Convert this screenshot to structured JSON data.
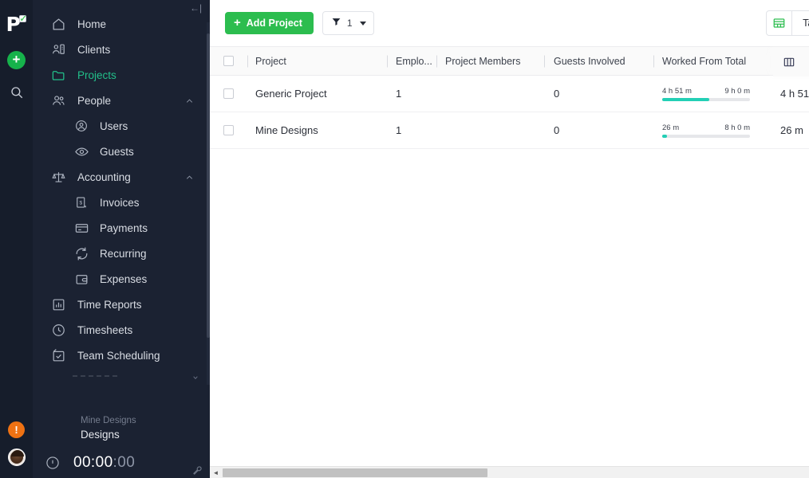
{
  "rail": {
    "logo_letter": "P",
    "logo_check": "✓",
    "add_label": "+",
    "search_icon": "search-icon",
    "alert_label": "!",
    "avatar_label": "avatar"
  },
  "sidebar": {
    "collapse_label": "←|",
    "items": [
      {
        "label": "Home",
        "icon": "home-icon",
        "level": 0,
        "active": false,
        "chevron": ""
      },
      {
        "label": "Clients",
        "icon": "clients-icon",
        "level": 0,
        "active": false,
        "chevron": ""
      },
      {
        "label": "Projects",
        "icon": "folder-icon",
        "level": 0,
        "active": true,
        "chevron": ""
      },
      {
        "label": "People",
        "icon": "people-icon",
        "level": 0,
        "active": false,
        "chevron": "up"
      },
      {
        "label": "Users",
        "icon": "user-circle-icon",
        "level": 1,
        "active": false,
        "chevron": ""
      },
      {
        "label": "Guests",
        "icon": "eye-icon",
        "level": 1,
        "active": false,
        "chevron": ""
      },
      {
        "label": "Accounting",
        "icon": "scales-icon",
        "level": 0,
        "active": false,
        "chevron": "up"
      },
      {
        "label": "Invoices",
        "icon": "invoice-icon",
        "level": 1,
        "active": false,
        "chevron": ""
      },
      {
        "label": "Payments",
        "icon": "card-icon",
        "level": 1,
        "active": false,
        "chevron": ""
      },
      {
        "label": "Recurring",
        "icon": "recurring-icon",
        "level": 1,
        "active": false,
        "chevron": ""
      },
      {
        "label": "Expenses",
        "icon": "wallet-icon",
        "level": 1,
        "active": false,
        "chevron": ""
      },
      {
        "label": "Time Reports",
        "icon": "bar-chart-icon",
        "level": 0,
        "active": false,
        "chevron": ""
      },
      {
        "label": "Timesheets",
        "icon": "clock-icon",
        "level": 0,
        "active": false,
        "chevron": ""
      },
      {
        "label": "Team Scheduling",
        "icon": "calendar-check-icon",
        "level": 0,
        "active": false,
        "chevron": ""
      }
    ],
    "timer": {
      "client": "Mine Designs",
      "project": "Designs",
      "time_hm": "00:00",
      "time_ss": ":00"
    }
  },
  "toolbar": {
    "add_project_plus": "+",
    "add_project_label": "Add Project",
    "filter_count": "1",
    "view_label": "Table"
  },
  "table": {
    "columns": [
      {
        "label": "Project"
      },
      {
        "label": "Emplo..."
      },
      {
        "label": "Project Members"
      },
      {
        "label": "Guests Involved"
      },
      {
        "label": "Worked From Total"
      }
    ],
    "rows": [
      {
        "project": "Generic Project",
        "employees": "1",
        "members": "",
        "guests": "0",
        "worked": "4 h 51 m",
        "total": "9 h 0 m",
        "percent": 54,
        "total_col": "4 h 51"
      },
      {
        "project": "Mine Designs",
        "employees": "1",
        "members": "",
        "guests": "0",
        "worked": "26 m",
        "total": "8 h 0 m",
        "percent": 5,
        "total_col": "26 m"
      }
    ],
    "float_tools": [
      "columns-icon",
      "sort-icon",
      "gear-icon"
    ]
  },
  "colors": {
    "accent_green": "#2cbd4f",
    "active_green": "#22c08a",
    "progress_teal": "#23cfb5",
    "chat_teal": "#16cfba",
    "alert_orange": "#ef7213",
    "sidebar_bg": "#1b2232",
    "rail_bg": "#161d2b"
  },
  "scrollbar": {
    "left_arrow": "◄"
  }
}
